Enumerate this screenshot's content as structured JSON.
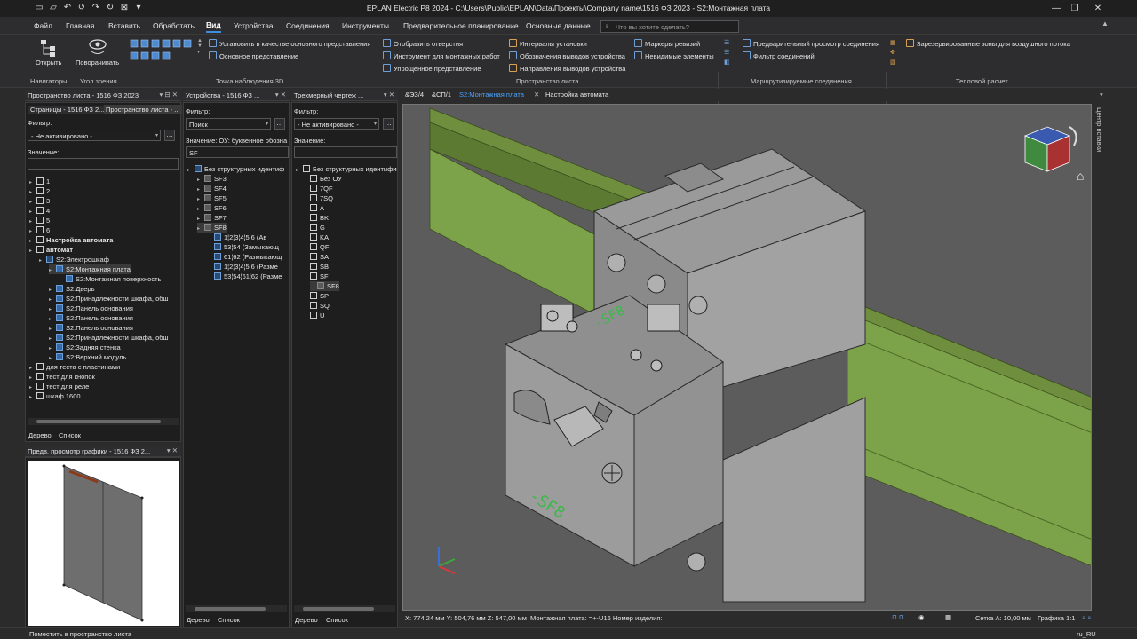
{
  "window": {
    "title": "EPLAN Electric P8 2024 - C:\\Users\\Public\\EPLAN\\Data\\Проекты\\Company name\\1516 ФЗ 2023 - S2:Монтажная плата"
  },
  "menu": {
    "items": [
      "Файл",
      "Главная",
      "Вставить",
      "Обработать",
      "Вид",
      "Устройства",
      "Соединения",
      "Инструменты",
      "Предварительное планирование",
      "Основные данные"
    ],
    "active": "Вид",
    "search_placeholder": "Что вы хотите сделать?"
  },
  "ribbon": {
    "open": "Открыть",
    "rotate": "Поворачивать",
    "set_main": "Установить в качестве основного представления",
    "main_view": "Основное представление",
    "show_holes": "Отобразить отверстия",
    "mount_tool": "Инструмент для монтажных работ",
    "simplified": "Упрощенное представление",
    "intervals": "Интервалы установки",
    "pin_labels": "Обозначения выводов устройства",
    "pin_dirs": "Направления выводов устройства",
    "rev_markers": "Маркеры ревизий",
    "invisible": "Невидимые элементы",
    "conn_preview": "Предварительный просмотр соединения",
    "conn_filter": "Фильтр соединений",
    "reserved_zones": "Зарезервированные зоны для воздушного потока",
    "groups": {
      "navigators": "Навигаторы",
      "view_angle": "Угол зрения",
      "viewpoint": "Точка наблюдения 3D",
      "layout_space": "Пространство листа",
      "routed": "Маршрутизируемые соединения",
      "thermal": "Тепловой расчет"
    }
  },
  "panel_pages": {
    "header": "Пространство листа - 1516 ФЗ 2023",
    "tab1": "Страницы - 1516 ФЗ 2...",
    "tab2": "Пространство листа - ...",
    "filter_label": "Фильтр:",
    "filter_value": "- Не активировано -",
    "value_label": "Значение:",
    "tree": [
      {
        "label": "1",
        "level": 0,
        "bold": false
      },
      {
        "label": "2",
        "level": 0,
        "bold": false
      },
      {
        "label": "3",
        "level": 0,
        "bold": false
      },
      {
        "label": "4",
        "level": 0,
        "bold": false
      },
      {
        "label": "5",
        "level": 0,
        "bold": false
      },
      {
        "label": "6",
        "level": 0,
        "bold": false
      },
      {
        "label": "Настройка автомата",
        "level": 0,
        "bold": true
      },
      {
        "label": "автомат",
        "level": 0,
        "bold": true
      },
      {
        "label": "S2:Электрошкаф",
        "level": 1,
        "bold": false
      },
      {
        "label": "S2:Монтажная плата",
        "level": 2,
        "bold": false
      },
      {
        "label": "S2:Монтажная поверхность",
        "level": 3,
        "bold": false
      },
      {
        "label": "S2:Дверь",
        "level": 2,
        "bold": false
      },
      {
        "label": "S2:Принадлежности шкафа, обш",
        "level": 2,
        "bold": false
      },
      {
        "label": "S2:Панель основания",
        "level": 2,
        "bold": false
      },
      {
        "label": "S2:Панель основания",
        "level": 2,
        "bold": false
      },
      {
        "label": "S2:Панель основания",
        "level": 2,
        "bold": false
      },
      {
        "label": "S2:Принадлежности шкафа, обш",
        "level": 2,
        "bold": false
      },
      {
        "label": "S2:Задняя стенка",
        "level": 2,
        "bold": false
      },
      {
        "label": "S2:Верхний модуль",
        "level": 2,
        "bold": false
      },
      {
        "label": "для теста с пластинами",
        "level": 0,
        "bold": false
      },
      {
        "label": "тест для кнопок",
        "level": 0,
        "bold": false
      },
      {
        "label": "тест для реле",
        "level": 0,
        "bold": false
      },
      {
        "label": "шкаф 1600",
        "level": 0,
        "bold": false
      }
    ],
    "tab_tree": "Дерево",
    "tab_list": "Список"
  },
  "panel_preview": {
    "header": "Предв. просмотр графики - 1516 ФЗ 2..."
  },
  "panel_devices": {
    "header": "Устройства - 1516 ФЗ ...",
    "filter_label": "Фильтр:",
    "filter_value": "Поиск",
    "value_label": "Значение: ОУ: буквенное обозна",
    "value": "SF",
    "tree": [
      {
        "label": "Без структурных идентиф",
        "level": 0
      },
      {
        "label": "SF3",
        "level": 1
      },
      {
        "label": "SF4",
        "level": 1
      },
      {
        "label": "SF5",
        "level": 1
      },
      {
        "label": "SF6",
        "level": 1
      },
      {
        "label": "SF7",
        "level": 1
      },
      {
        "label": "SF8",
        "level": 1
      },
      {
        "label": "1¦2¦3¦4¦5¦6 (Ав",
        "level": 2
      },
      {
        "label": "53¦54 (Замыкающ",
        "level": 2
      },
      {
        "label": "61¦62 (Размыкающ",
        "level": 2
      },
      {
        "label": "1¦2¦3¦4¦5¦6 (Разме",
        "level": 2
      },
      {
        "label": "53¦54¦61¦62 (Разме",
        "level": 2
      }
    ],
    "tab_tree": "Дерево",
    "tab_list": "Список"
  },
  "panel_3d": {
    "header": "Трехмерный чертеж ...",
    "filter_label": "Фильтр:",
    "filter_value": "- Не активировано -",
    "value_label": "Значение:",
    "tree": [
      {
        "label": "Без структурных идентификатор",
        "level": 0
      },
      {
        "label": "Без ОУ",
        "level": 1
      },
      {
        "label": "7QF",
        "level": 1
      },
      {
        "label": "7SQ",
        "level": 1
      },
      {
        "label": "A",
        "level": 1
      },
      {
        "label": "BK",
        "level": 1
      },
      {
        "label": "G",
        "level": 1
      },
      {
        "label": "KA",
        "level": 1
      },
      {
        "label": "QF",
        "level": 1
      },
      {
        "label": "SA",
        "level": 1
      },
      {
        "label": "SB",
        "level": 1
      },
      {
        "label": "SF",
        "level": 1
      },
      {
        "label": "SF8",
        "level": 2
      },
      {
        "label": "SP",
        "level": 1
      },
      {
        "label": "SQ",
        "level": 1
      },
      {
        "label": "U",
        "level": 1
      }
    ],
    "tab_tree": "Дерево",
    "tab_list": "Список"
  },
  "doc_tabs": [
    "&ЭЗ/4",
    "&СП/1",
    "S2:Монтажная плата",
    "Настройка автомата"
  ],
  "active_doc_tab": "S2:Монтажная плата",
  "viewport": {
    "device_label": "-SF8",
    "right_strip_label": "Центр вставки"
  },
  "status3d": {
    "coords": "X: 774,24 мм Y: 504,76 мм Z: 547,00 мм",
    "info": "Монтажная плата: =+-U16 Номер изделия:",
    "grid": "Сетка A: 10,00 мм",
    "scale": "Графика 1:1"
  },
  "statusbar": {
    "left": "Поместить в пространство листа",
    "right": "ru_RU"
  }
}
